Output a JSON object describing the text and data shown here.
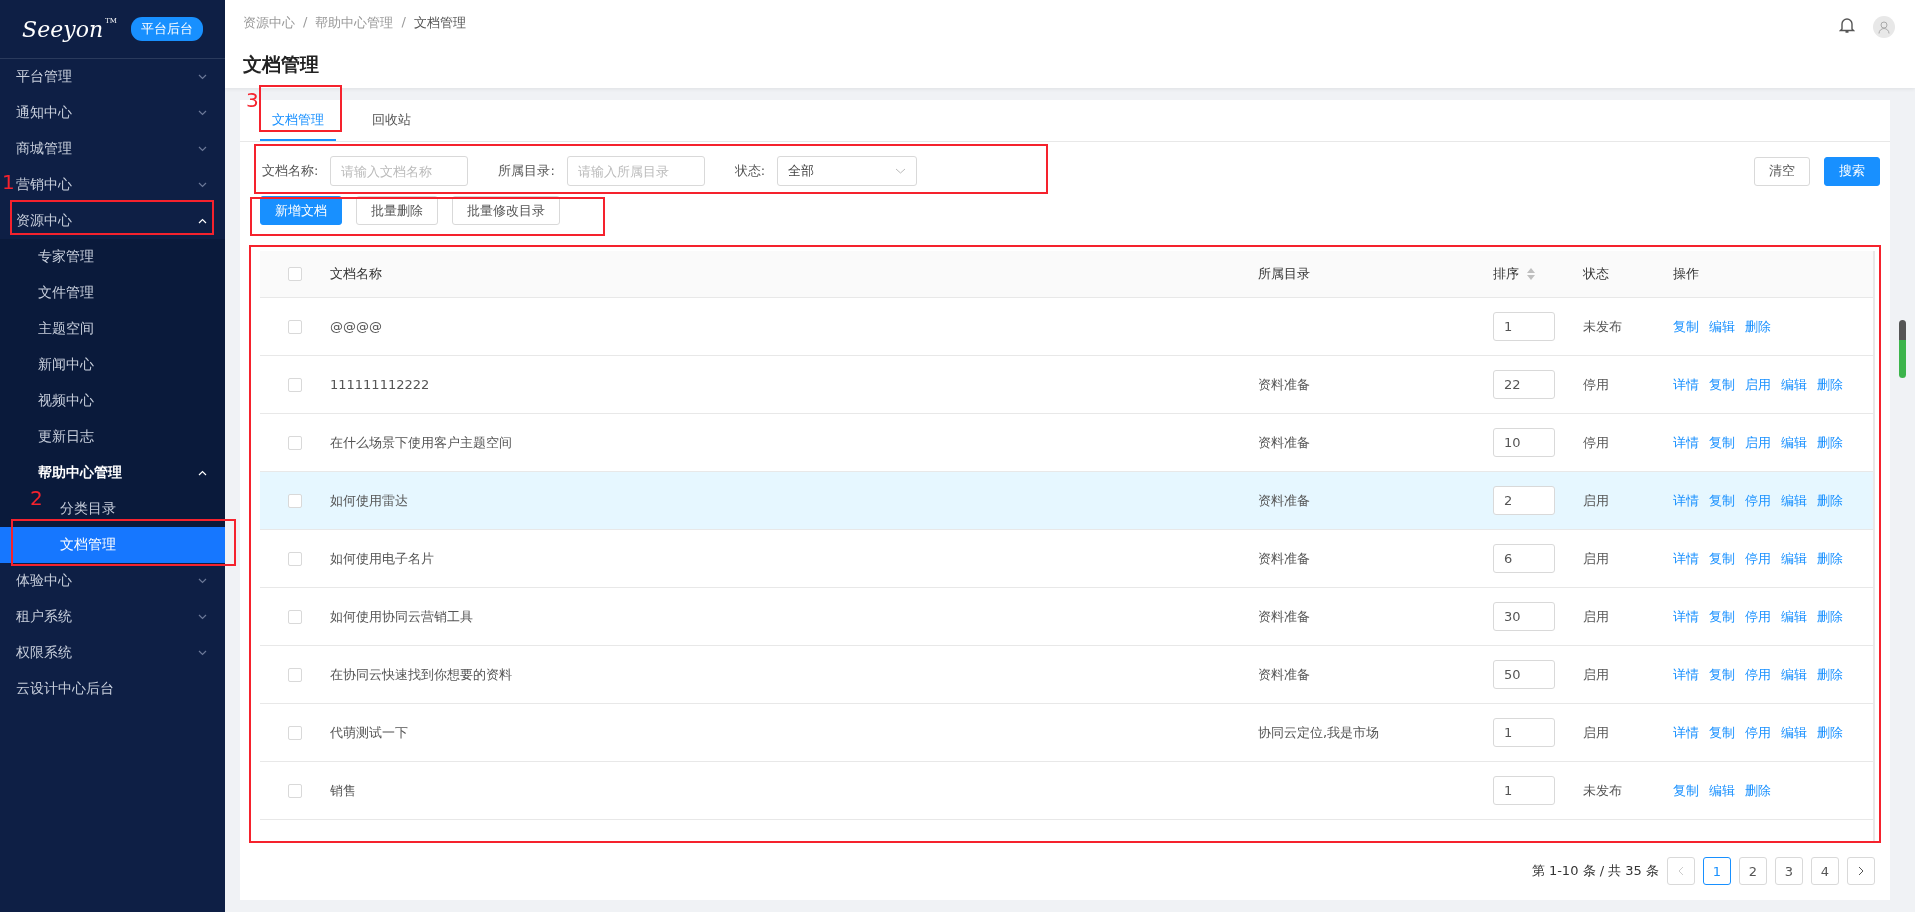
{
  "sidebar": {
    "logo": "Seeyon",
    "logo_mark": "TM",
    "badge": "平台后台",
    "items": [
      {
        "kind": "group",
        "label": "平台管理",
        "expanded": false
      },
      {
        "kind": "group",
        "label": "通知中心",
        "expanded": false
      },
      {
        "kind": "group",
        "label": "商城管理",
        "expanded": false
      },
      {
        "kind": "group",
        "label": "营销中心",
        "expanded": false
      },
      {
        "kind": "group",
        "label": "资源中心",
        "expanded": true,
        "children": [
          {
            "kind": "link",
            "label": "专家管理",
            "selected": false
          },
          {
            "kind": "link",
            "label": "文件管理",
            "selected": false
          },
          {
            "kind": "link",
            "label": "主题空间",
            "selected": false
          },
          {
            "kind": "link",
            "label": "新闻中心",
            "selected": false
          },
          {
            "kind": "link",
            "label": "视频中心",
            "selected": false
          },
          {
            "kind": "link",
            "label": "更新日志",
            "selected": false
          },
          {
            "kind": "group",
            "label": "帮助中心管理",
            "expanded": true,
            "children": [
              {
                "kind": "link",
                "label": "分类目录",
                "selected": false
              },
              {
                "kind": "link",
                "label": "文档管理",
                "selected": true
              }
            ]
          }
        ]
      },
      {
        "kind": "group",
        "label": "体验中心",
        "expanded": false
      },
      {
        "kind": "group",
        "label": "租户系统",
        "expanded": false
      },
      {
        "kind": "group",
        "label": "权限系统",
        "expanded": false
      },
      {
        "kind": "link",
        "label": "云设计中心后台",
        "selected": false
      }
    ]
  },
  "header": {
    "separator": "/",
    "breadcrumb": [
      "资源中心",
      "帮助中心管理",
      "文档管理"
    ],
    "title": "文档管理"
  },
  "tabs": [
    {
      "label": "文档管理",
      "selected": true
    },
    {
      "label": "回收站",
      "selected": false
    }
  ],
  "filters": [
    {
      "kind": "input",
      "label": "文档名称:",
      "placeholder": "请输入文档名称"
    },
    {
      "kind": "input",
      "label": "所属目录:",
      "placeholder": "请输入所属目录"
    },
    {
      "kind": "select",
      "label": "状态:",
      "value": "全部"
    }
  ],
  "filter_buttons": [
    {
      "label": "清空",
      "primary": false
    },
    {
      "label": "搜索",
      "primary": true
    }
  ],
  "actions": [
    {
      "label": "新增文档",
      "primary": true
    },
    {
      "label": "批量删除",
      "primary": false
    },
    {
      "label": "批量修改目录",
      "primary": false
    }
  ],
  "table": {
    "columns": [
      "文档名称",
      "所属目录",
      "排序",
      "状态",
      "操作"
    ],
    "header_checked": false,
    "rows": [
      {
        "checked": false,
        "hovered": false,
        "name": "@@@@",
        "catalog": "",
        "sort": "1",
        "status": "未发布",
        "ops": [
          "复制",
          "编辑",
          "删除"
        ]
      },
      {
        "checked": false,
        "hovered": false,
        "name": "111111112222",
        "catalog": "资料准备",
        "sort": "22",
        "status": "停用",
        "ops": [
          "详情",
          "复制",
          "启用",
          "编辑",
          "删除"
        ]
      },
      {
        "checked": false,
        "hovered": false,
        "name": "在什么场景下使用客户主题空间",
        "catalog": "资料准备",
        "sort": "10",
        "status": "停用",
        "ops": [
          "详情",
          "复制",
          "启用",
          "编辑",
          "删除"
        ]
      },
      {
        "checked": false,
        "hovered": true,
        "name": "如何使用雷达",
        "catalog": "资料准备",
        "sort": "2",
        "status": "启用",
        "ops": [
          "详情",
          "复制",
          "停用",
          "编辑",
          "删除"
        ]
      },
      {
        "checked": false,
        "hovered": false,
        "name": "如何使用电子名片",
        "catalog": "资料准备",
        "sort": "6",
        "status": "启用",
        "ops": [
          "详情",
          "复制",
          "停用",
          "编辑",
          "删除"
        ]
      },
      {
        "checked": false,
        "hovered": false,
        "name": "如何使用协同云营销工具",
        "catalog": "资料准备",
        "sort": "30",
        "status": "启用",
        "ops": [
          "详情",
          "复制",
          "停用",
          "编辑",
          "删除"
        ]
      },
      {
        "checked": false,
        "hovered": false,
        "name": "在协同云快速找到你想要的资料",
        "catalog": "资料准备",
        "sort": "50",
        "status": "启用",
        "ops": [
          "详情",
          "复制",
          "停用",
          "编辑",
          "删除"
        ]
      },
      {
        "checked": false,
        "hovered": false,
        "name": "代萌测试一下",
        "catalog": "协同云定位,我是市场",
        "sort": "1",
        "status": "启用",
        "ops": [
          "详情",
          "复制",
          "停用",
          "编辑",
          "删除"
        ]
      },
      {
        "checked": false,
        "hovered": false,
        "name": "销售",
        "catalog": "",
        "sort": "1",
        "status": "未发布",
        "ops": [
          "复制",
          "编辑",
          "删除"
        ]
      }
    ]
  },
  "pagination": {
    "summary": "第 1-10 条 / 共 35 条",
    "pages": [
      {
        "label": "1",
        "selected": true
      },
      {
        "label": "2",
        "selected": false
      },
      {
        "label": "3",
        "selected": false
      },
      {
        "label": "4",
        "selected": false
      }
    ]
  },
  "annotations": [
    "1",
    "2",
    "3"
  ]
}
